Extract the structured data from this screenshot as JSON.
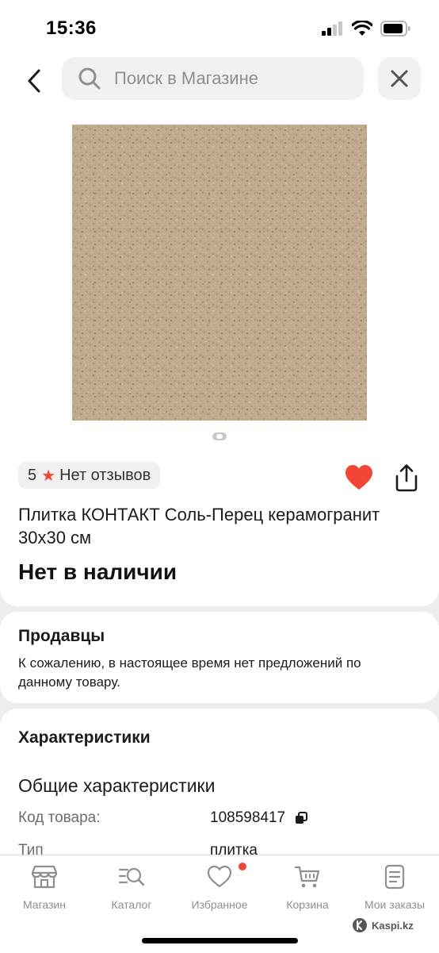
{
  "status_bar": {
    "time": "15:36"
  },
  "header": {
    "search_placeholder": "Поиск в Магазине"
  },
  "product": {
    "rating": "5",
    "reviews_label": "Нет отзывов",
    "title": "Плитка КОНТАКТ Соль-Перец керамогранит 30х30 см",
    "availability": "Нет в наличии",
    "favorited": true,
    "accent_color": "#f14635"
  },
  "sellers": {
    "title": "Продавцы",
    "message": "К сожалению, в настоящее время нет предложений по данному товару."
  },
  "specs": {
    "title": "Характеристики",
    "section_title": "Общие характеристики",
    "rows": [
      {
        "label": "Код товара:",
        "value": "108598417"
      },
      {
        "label": "Тип",
        "value": "плитка"
      }
    ]
  },
  "tab_bar": {
    "items": [
      {
        "label": "Магазин",
        "icon": "shop-icon"
      },
      {
        "label": "Каталог",
        "icon": "catalog-search-icon"
      },
      {
        "label": "Избранное",
        "icon": "heart-icon"
      },
      {
        "label": "Корзина",
        "icon": "cart-icon"
      },
      {
        "label": "Мои заказы",
        "icon": "orders-icon"
      }
    ],
    "watermark": "Kaspi.kz"
  }
}
